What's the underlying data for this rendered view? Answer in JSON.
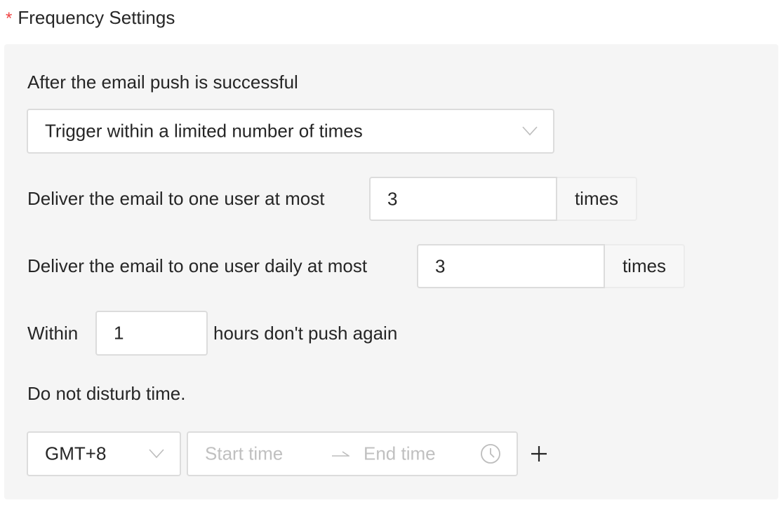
{
  "section": {
    "required_mark": "*",
    "title": "Frequency Settings"
  },
  "after_push": {
    "label": "After the email push is successful",
    "select_value": "Trigger within a limited number of times"
  },
  "max_total": {
    "label": "Deliver the email to one user at most",
    "value": "3",
    "unit": "times"
  },
  "max_daily": {
    "label": "Deliver the email to one user daily at most",
    "value": "3",
    "unit": "times"
  },
  "cooldown": {
    "prefix": "Within",
    "value": "1",
    "suffix": "hours don't push again"
  },
  "dnd": {
    "label": "Do not disturb time.",
    "timezone": "GMT+8",
    "start_placeholder": "Start time",
    "end_placeholder": "End time",
    "icons": {
      "timezone_dropdown": "chevron-down-icon",
      "range_separator": "arrow-right-icon",
      "time_picker": "clock-icon",
      "add": "plus-icon"
    }
  }
}
